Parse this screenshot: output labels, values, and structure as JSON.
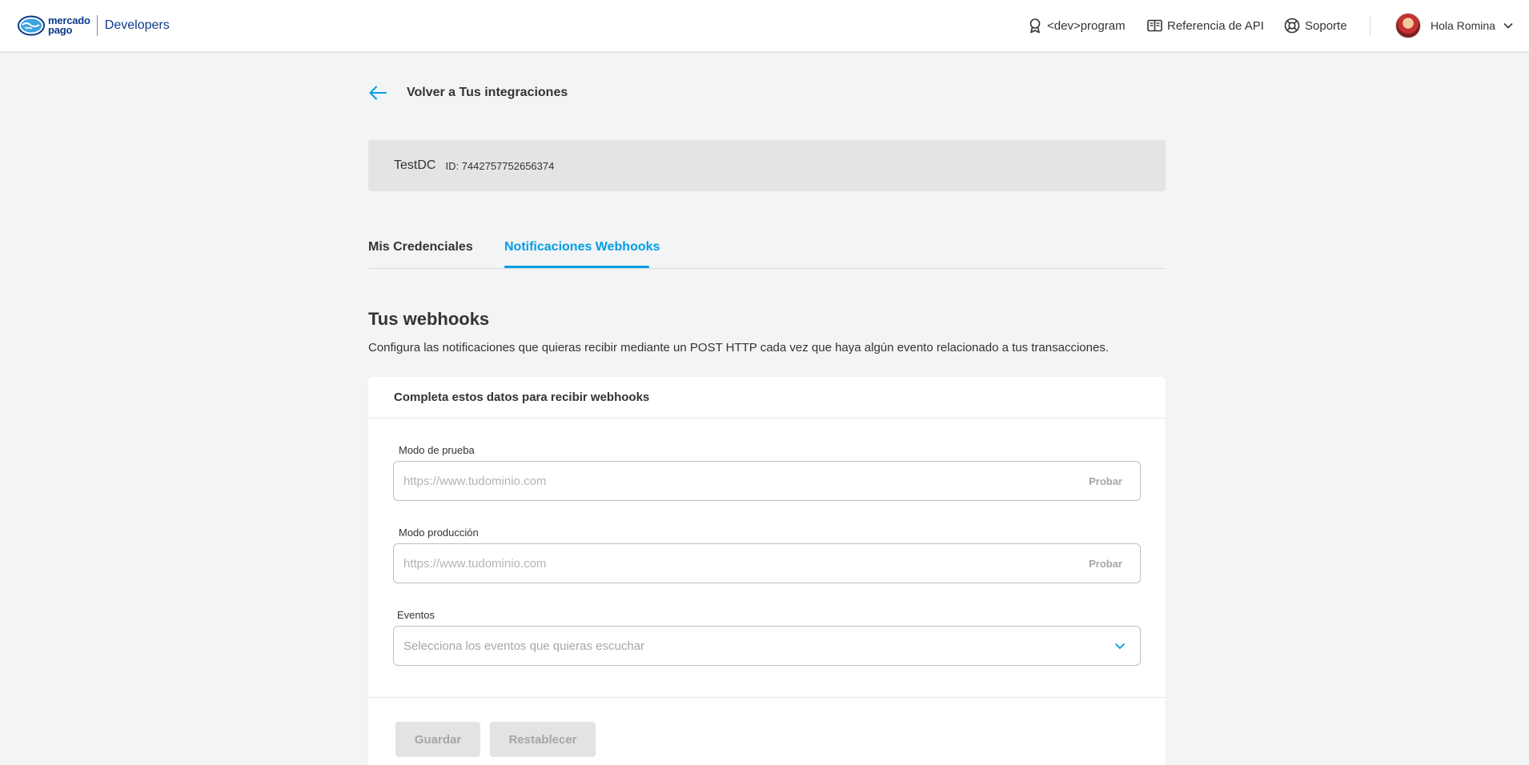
{
  "brand": {
    "logo_text_line1": "mercado",
    "logo_text_line2": "pago",
    "product": "Developers",
    "color": "#0b3a8c"
  },
  "header_nav": {
    "items": [
      {
        "label": "<dev>program",
        "icon": "ribbon-icon"
      },
      {
        "label": "Referencia de API",
        "icon": "book-icon"
      },
      {
        "label": "Soporte",
        "icon": "lifebuoy-icon"
      }
    ],
    "user_greeting": "Hola Romina"
  },
  "back_link": {
    "label": "Volver a Tus integraciones"
  },
  "app": {
    "name": "TestDC",
    "id": "ID: 7442757752656374"
  },
  "tabs": [
    {
      "label": "Mis Credenciales",
      "active": false
    },
    {
      "label": "Notificaciones Webhooks",
      "active": true
    }
  ],
  "section": {
    "title": "Tus webhooks",
    "description": "Configura las notificaciones que quieras recibir mediante un POST HTTP cada vez que haya algún evento relacionado a tus transacciones."
  },
  "form": {
    "header": "Completa estos datos para recibir webhooks",
    "test_mode": {
      "label": "Modo de prueba",
      "placeholder": "https://www.tudominio.com",
      "value": "",
      "action": "Probar"
    },
    "production_mode": {
      "label": "Modo producción",
      "placeholder": "https://www.tudominio.com",
      "value": "",
      "action": "Probar"
    },
    "events": {
      "label": "Eventos",
      "placeholder": "Selecciona los eventos que quieras escuchar"
    },
    "save_label": "Guardar",
    "reset_label": "Restablecer"
  },
  "colors": {
    "accent": "#009ee3",
    "background": "#f3f4f6",
    "disabled": "#e3e3e3"
  }
}
